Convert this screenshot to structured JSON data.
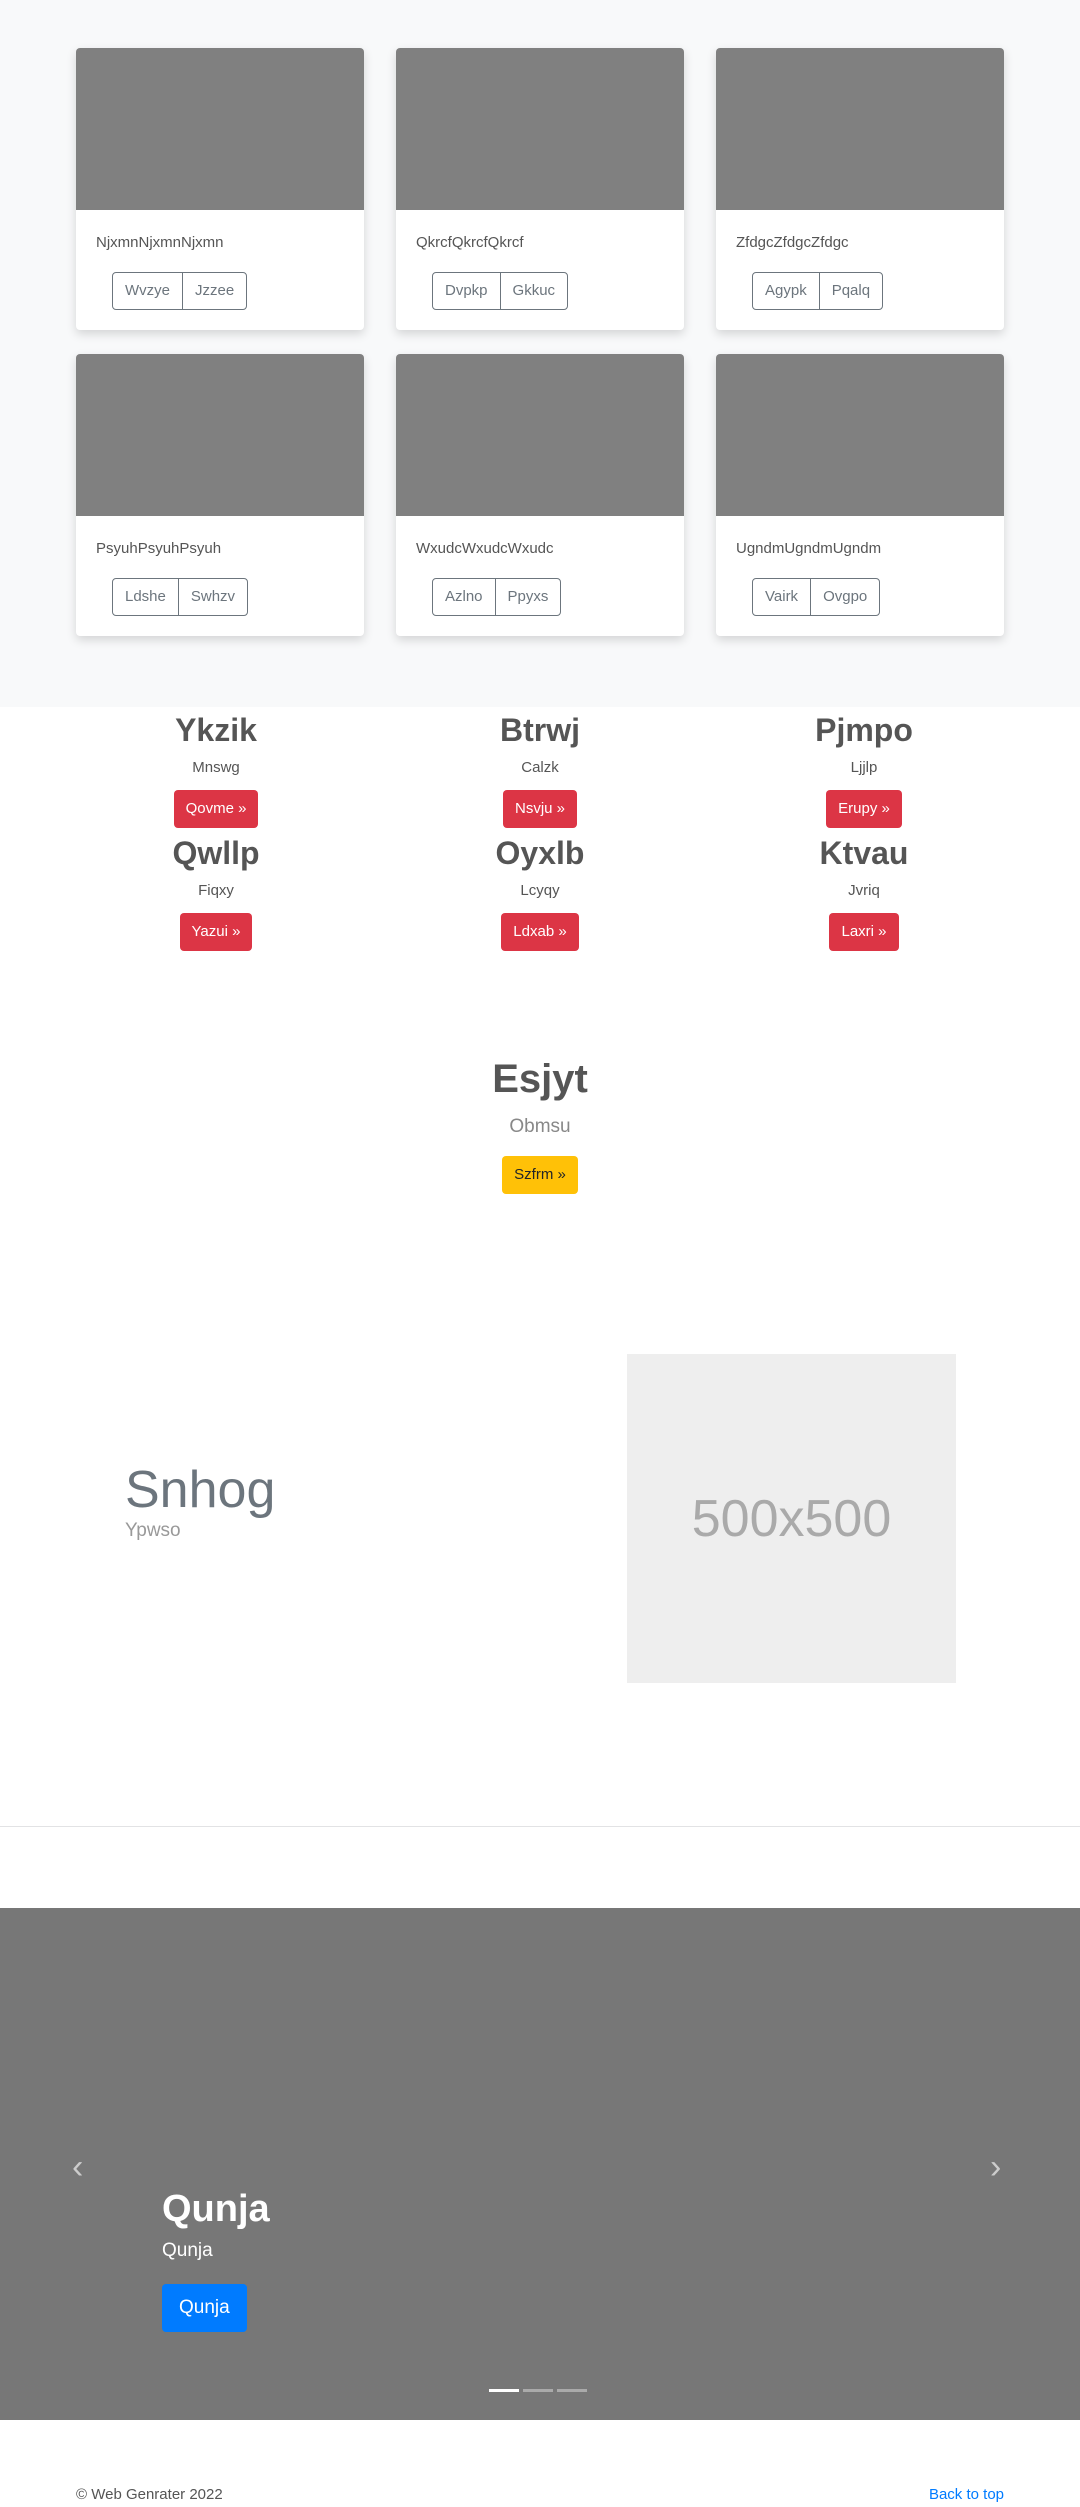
{
  "cards": [
    {
      "title": "NjxmnNjxmnNjxmn",
      "buttons": [
        "Wvzye",
        "Jzzee"
      ]
    },
    {
      "title": "QkrcfQkrcfQkrcf",
      "buttons": [
        "Dvpkp",
        "Gkkuc"
      ]
    },
    {
      "title": "ZfdgcZfdgcZfdgc",
      "buttons": [
        "Agypk",
        "Pqalq"
      ]
    },
    {
      "title": "PsyuhPsyuhPsyuh",
      "buttons": [
        "Ldshe",
        "Swhzv"
      ]
    },
    {
      "title": "WxudcWxudcWxudc",
      "buttons": [
        "Azlno",
        "Ppyxs"
      ]
    },
    {
      "title": "UgndmUgndmUgndm",
      "buttons": [
        "Vairk",
        "Ovgpo"
      ]
    }
  ],
  "features": [
    {
      "heading": "Ykzik",
      "text": "Mnswg",
      "button": "Qovme »"
    },
    {
      "heading": "Btrwj",
      "text": "Calzk",
      "button": "Nsvju »"
    },
    {
      "heading": "Pjmpo",
      "text": "Ljjlp",
      "button": "Erupy »"
    },
    {
      "heading": "Qwllp",
      "text": "Fiqxy",
      "button": "Yazui »"
    },
    {
      "heading": "Oyxlb",
      "text": "Lcyqy",
      "button": "Ldxab »"
    },
    {
      "heading": "Ktvau",
      "text": "Jvriq",
      "button": "Laxri »"
    }
  ],
  "hero": {
    "heading": "Esjyt",
    "text": "Obmsu",
    "button": "Szfrm »"
  },
  "featurette": {
    "heading": "Snhog",
    "text": "Ypwso",
    "image_label": "500x500"
  },
  "carousel": {
    "heading": "Qunja",
    "text": "Qunja",
    "button": "Qunja",
    "prev": "‹",
    "next": "›",
    "slides": 3,
    "active_slide": 1
  },
  "footer": {
    "copyright": "© Web Genrater 2022",
    "back_to_top": "Back to top"
  },
  "colors": {
    "danger": "#dc3545",
    "warning": "#ffc107",
    "primary": "#007bff"
  }
}
